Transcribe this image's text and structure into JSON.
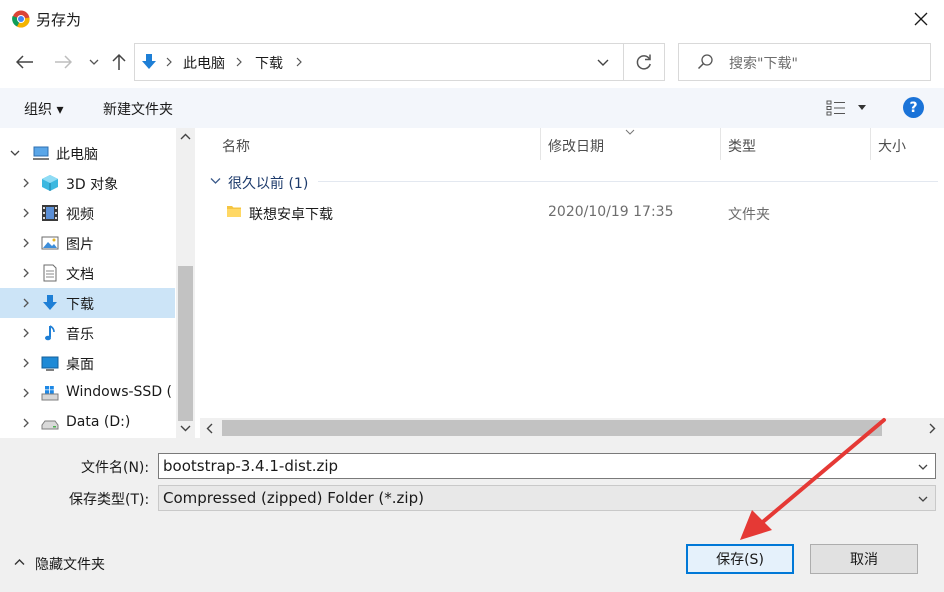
{
  "window": {
    "title": "另存为"
  },
  "nav": {
    "crumbs": [
      "此电脑",
      "下载"
    ]
  },
  "search": {
    "placeholder": "搜索\"下载\""
  },
  "toolbar": {
    "organize": "组织 ▾",
    "new_folder": "新建文件夹",
    "help": "?"
  },
  "tree": [
    {
      "label": "此电脑",
      "icon": "computer-icon",
      "expanded": true
    },
    {
      "label": "3D 对象",
      "icon": "cube-icon"
    },
    {
      "label": "视频",
      "icon": "film-icon"
    },
    {
      "label": "图片",
      "icon": "picture-icon"
    },
    {
      "label": "文档",
      "icon": "document-icon"
    },
    {
      "label": "下载",
      "icon": "download-icon",
      "selected": true
    },
    {
      "label": "音乐",
      "icon": "music-icon"
    },
    {
      "label": "桌面",
      "icon": "desktop-icon"
    },
    {
      "label": "Windows-SSD (",
      "icon": "windows-drive-icon"
    },
    {
      "label": "Data (D:)",
      "icon": "drive-icon"
    }
  ],
  "columns": {
    "name": "名称",
    "modified": "修改日期",
    "type": "类型",
    "size": "大小"
  },
  "group": {
    "label": "很久以前 (1)"
  },
  "files": [
    {
      "name": "联想安卓下载",
      "modified": "2020/10/19 17:35",
      "type": "文件夹"
    }
  ],
  "form": {
    "filename_label": "文件名(N):",
    "filename_value": "bootstrap-3.4.1-dist.zip",
    "filetype_label": "保存类型(T):",
    "filetype_value": "Compressed (zipped) Folder (*.zip)"
  },
  "footer": {
    "hide_folders": "隐藏文件夹",
    "save": "保存(S)",
    "cancel": "取消"
  },
  "colors": {
    "accent": "#0078d7",
    "selection": "#cce4f7",
    "annotation_arrow": "#e53935"
  }
}
